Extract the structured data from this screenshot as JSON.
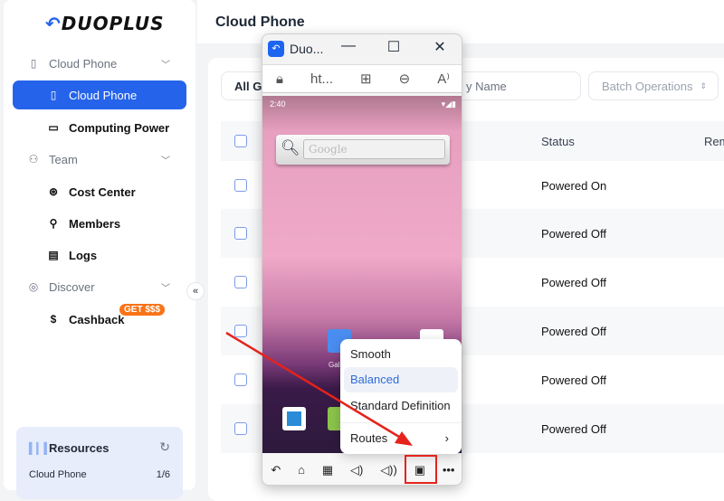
{
  "sidebar": {
    "logo": "DUOPLUS",
    "items": [
      {
        "label": "Cloud Phone",
        "icon": "phone-icon",
        "type": "group"
      },
      {
        "label": "Cloud Phone",
        "icon": "phone-icon",
        "type": "active"
      },
      {
        "label": "Computing Power",
        "icon": "monitor-icon",
        "type": "sub"
      },
      {
        "label": "Team",
        "icon": "users-icon",
        "type": "group"
      },
      {
        "label": "Cost Center",
        "icon": "dollar-circle-icon",
        "type": "sub"
      },
      {
        "label": "Members",
        "icon": "members-icon",
        "type": "sub"
      },
      {
        "label": "Logs",
        "icon": "document-icon",
        "type": "sub"
      },
      {
        "label": "Discover",
        "icon": "compass-icon",
        "type": "group"
      },
      {
        "label": "Cashback",
        "icon": "dollar-icon",
        "type": "sub"
      }
    ],
    "cashback_badge": "GET $$$",
    "resources": {
      "title": "Resources",
      "items": [
        {
          "label": "Cloud Phone",
          "value": "1/6"
        }
      ]
    }
  },
  "header": {
    "title": "Cloud Phone"
  },
  "filters": {
    "group": "All Gr",
    "search": "y Name",
    "batch": "Batch Operations"
  },
  "table": {
    "headers": {
      "status": "Status",
      "remark": "Rem"
    },
    "rows": [
      {
        "status": "Powered On"
      },
      {
        "status": "Powered Off"
      },
      {
        "status": "Powered Off"
      },
      {
        "status": "Powered Off"
      },
      {
        "status": "Powered Off"
      },
      {
        "status": "Powered Off"
      }
    ]
  },
  "phone_window": {
    "title": "Duo...",
    "url": "ht...",
    "time": "2:40",
    "search_placeholder": "Google",
    "app_label": "Gall",
    "menu": {
      "items": [
        "Smooth",
        "Balanced",
        "Standard Definition"
      ],
      "selected": "Balanced",
      "routes": "Routes"
    }
  },
  "colors": {
    "accent": "#2563eb",
    "badge": "#f97316",
    "highlight": "#e5231b"
  }
}
